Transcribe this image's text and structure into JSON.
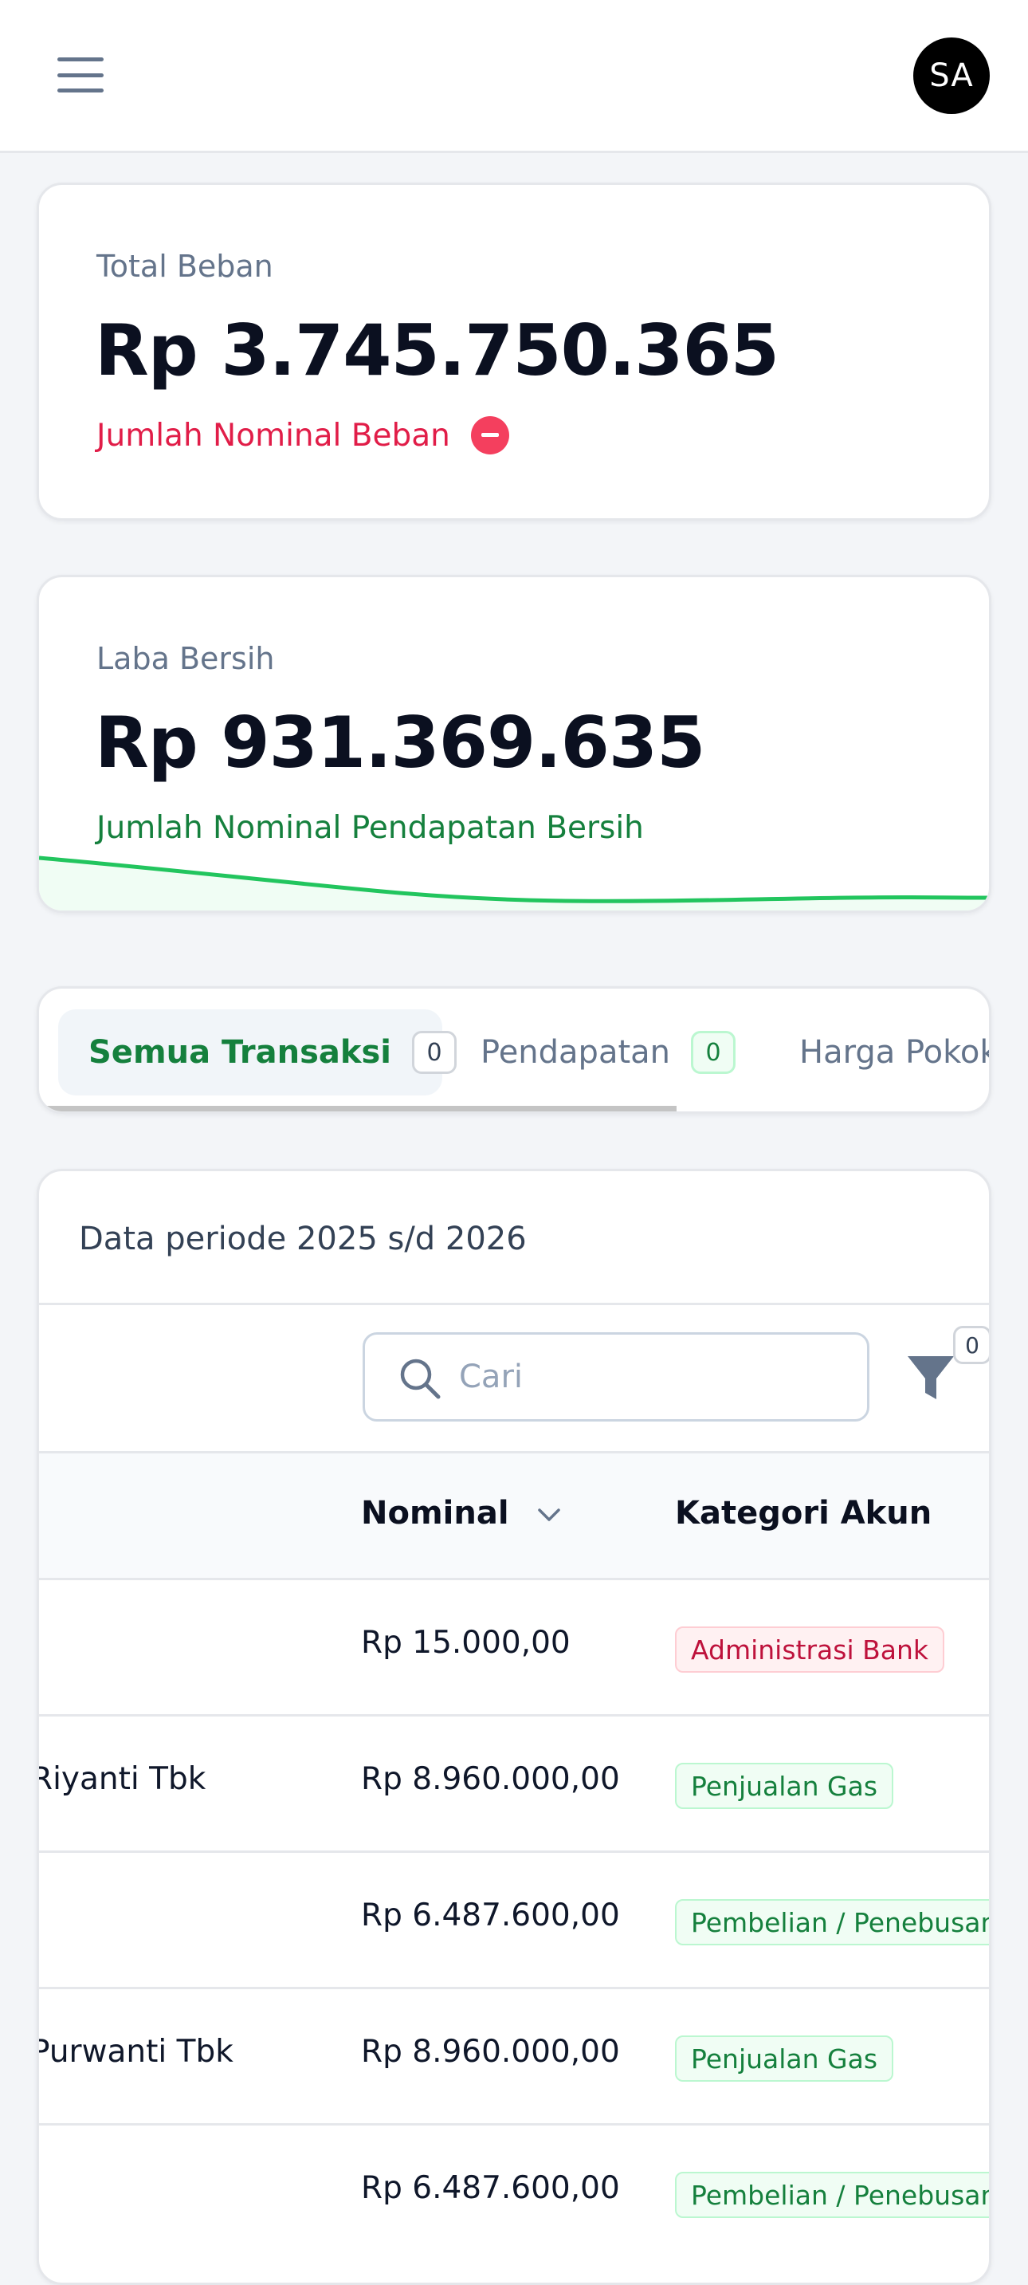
{
  "header": {
    "menu_icon": "hamburger-menu-icon",
    "avatar_initials": "SA"
  },
  "stats": {
    "beban": {
      "label": "Total Beban",
      "value": "Rp 3.745.750.365",
      "subtitle": "Jumlah Nominal Beban",
      "subtitle_color": "#e11d48",
      "icon": "minus-circle-icon"
    },
    "laba": {
      "label": "Laba Bersih",
      "value": "Rp 931.369.635",
      "subtitle": "Jumlah Nominal Pendapatan Bersih",
      "subtitle_color": "#15803d",
      "sparkline_color": "#22c55e"
    }
  },
  "tabs": [
    {
      "label": "Semua Transaksi",
      "count": "0",
      "active": true
    },
    {
      "label": "Pendapatan",
      "count": "0",
      "active": false
    },
    {
      "label": "Harga Pokok",
      "active": false
    }
  ],
  "table": {
    "period_text": "Data periode 2025 s/d 2026",
    "search_placeholder": "Cari",
    "filter_count": "0",
    "columns": {
      "nominal": "Nominal",
      "kategori": "Kategori Akun"
    },
    "rows": [
      {
        "name": "",
        "nominal": "Rp 15.000,00",
        "kategori": "Administrasi Bank",
        "tone": "red"
      },
      {
        "name": "Riyanti Tbk",
        "nominal": "Rp 8.960.000,00",
        "kategori": "Penjualan Gas",
        "tone": "green"
      },
      {
        "name": "",
        "nominal": "Rp 6.487.600,00",
        "kategori": "Pembelian / Penebusan",
        "tone": "green"
      },
      {
        "name": "Purwanti Tbk",
        "nominal": "Rp 8.960.000,00",
        "kategori": "Penjualan Gas",
        "tone": "green"
      },
      {
        "name": "",
        "nominal": "Rp 6.487.600,00",
        "kategori": "Pembelian / Penebusan",
        "tone": "green"
      }
    ]
  }
}
